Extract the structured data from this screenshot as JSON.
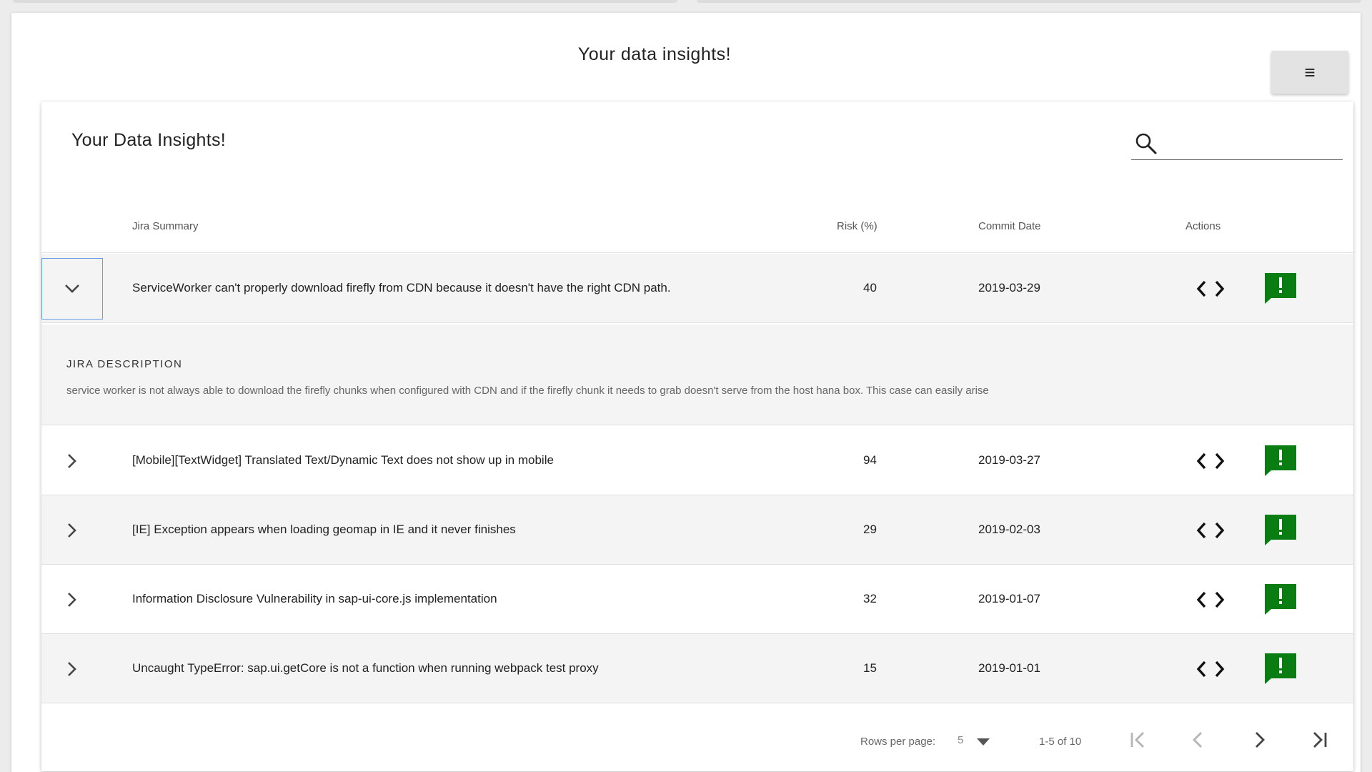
{
  "app": {
    "title": "Your data insights!",
    "menu_icon": "≡"
  },
  "table": {
    "title": "Your Data Insights!",
    "search": {
      "placeholder": "",
      "value": ""
    },
    "columns": {
      "summary": "Jira Summary",
      "risk": "Risk (%)",
      "date": "Commit Date",
      "actions": "Actions"
    },
    "rows": [
      {
        "summary": "ServiceWorker can't properly download firefly from CDN because it doesn't have the right CDN path.",
        "risk": "40",
        "date": "2019-03-29",
        "expanded": true
      },
      {
        "summary": "[Mobile][TextWidget] Translated Text/Dynamic Text does not show up in mobile",
        "risk": "94",
        "date": "2019-03-27",
        "expanded": false
      },
      {
        "summary": "[IE] Exception appears when loading geomap in IE and it never finishes",
        "risk": "29",
        "date": "2019-02-03",
        "expanded": false
      },
      {
        "summary": "Information Disclosure Vulnerability in sap-ui-core.js implementation",
        "risk": "32",
        "date": "2019-01-07",
        "expanded": false
      },
      {
        "summary": "Uncaught TypeError: sap.ui.getCore is not a function when running webpack test proxy",
        "risk": "15",
        "date": "2019-01-01",
        "expanded": false
      }
    ],
    "details": {
      "title": "JIRA DESCRIPTION",
      "text": "service worker is not always able to download the firefly chunks when configured with CDN and if the firefly chunk it needs to grab doesn't serve from the host hana box.  This case can easily arise"
    },
    "footer": {
      "rows_per_page_label": "Rows per page:",
      "rows_per_page_value": "5",
      "range": "1-5 of 10"
    }
  },
  "icons": {
    "expand": "chevron-down-icon",
    "collapse": "chevron-right-icon",
    "code": "code-icon",
    "feedback": "feedback-icon",
    "search": "search-icon"
  },
  "colors": {
    "feedback": "#0a7d12",
    "focus_border": "#6a9de8",
    "row_alt": "#f4f4f4"
  }
}
